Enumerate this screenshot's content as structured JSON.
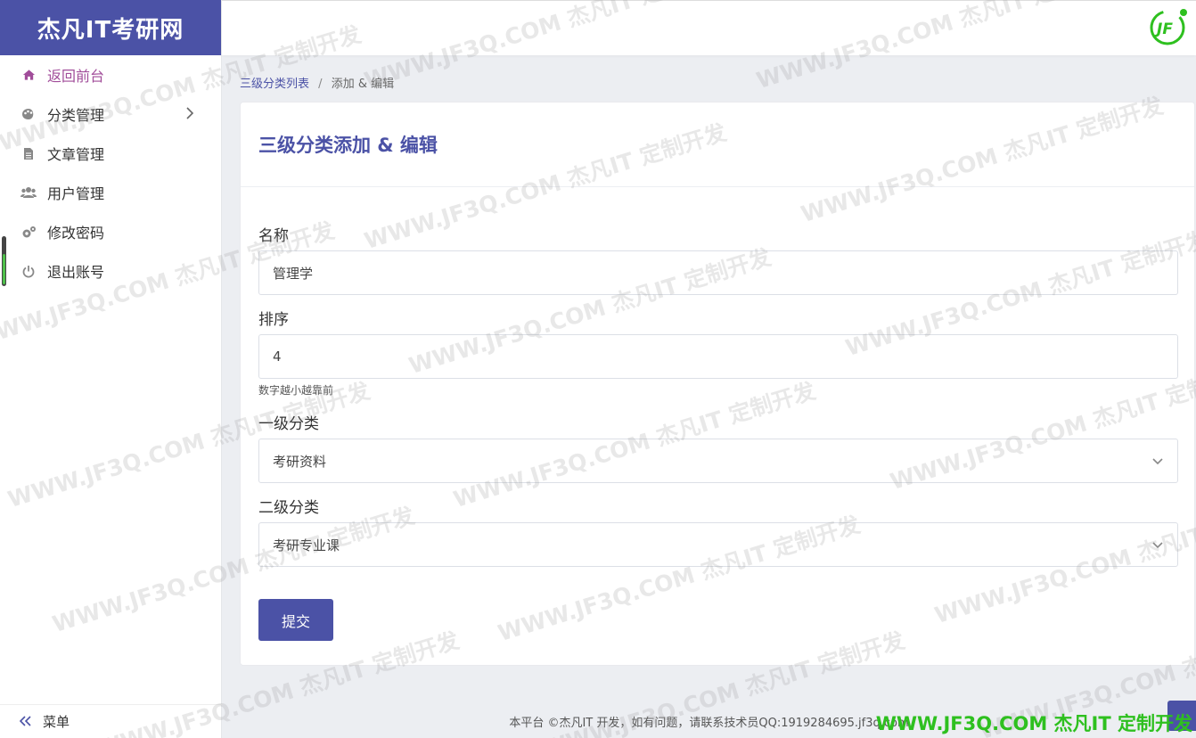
{
  "brand": {
    "title": "杰凡IT考研网"
  },
  "sidebar": {
    "items": [
      {
        "label": "返回前台",
        "icon": "home-icon"
      },
      {
        "label": "分类管理",
        "icon": "palette-icon"
      },
      {
        "label": "文章管理",
        "icon": "document-icon"
      },
      {
        "label": "用户管理",
        "icon": "users-icon"
      },
      {
        "label": "修改密码",
        "icon": "gears-icon"
      },
      {
        "label": "退出账号",
        "icon": "power-icon"
      }
    ],
    "collapse_label": "菜单"
  },
  "breadcrumb": {
    "parent": "三级分类列表",
    "separator": "/",
    "current": "添加 & 编辑"
  },
  "card": {
    "title": "三级分类添加 & 编辑",
    "fields": {
      "name": {
        "label": "名称",
        "value": "管理学"
      },
      "sort": {
        "label": "排序",
        "value": "4",
        "help": "数字越小越靠前"
      },
      "level1": {
        "label": "一级分类",
        "value": "考研资料"
      },
      "level2": {
        "label": "二级分类",
        "value": "考研专业课"
      }
    },
    "submit_label": "提交"
  },
  "footer": {
    "text": "本平台 ©杰凡IT 开发，如有问题，请联系技术员QQ:1919284695.jf3q.com"
  },
  "watermark": {
    "text": "WWW.JF3Q.COM 杰凡IT  定制开发",
    "corner": "WWW.JF3Q.COM 杰凡IT  定制开发"
  },
  "colors": {
    "primary": "#4b52a6",
    "active": "#a14d9a",
    "logo_green": "#2ec01f"
  }
}
